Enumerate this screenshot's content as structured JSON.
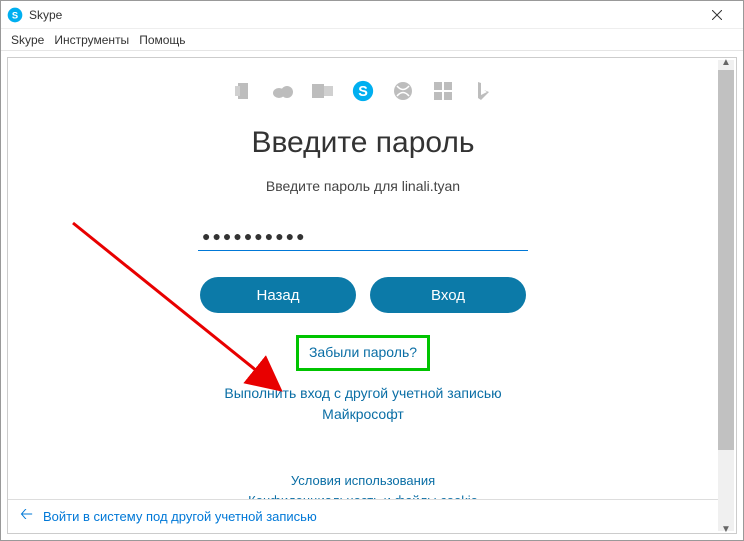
{
  "titlebar": {
    "app_name": "Skype"
  },
  "menubar": {
    "items": [
      "Skype",
      "Инструменты",
      "Помощь"
    ]
  },
  "icons": [
    "office-icon",
    "onedrive-icon",
    "outlook-icon",
    "skype-icon",
    "xbox-icon",
    "windows-icon",
    "bing-icon"
  ],
  "main": {
    "heading": "Введите пароль",
    "subtitle": "Введите пароль для linali.tyan",
    "password_masked": "●●●●●●●●●●",
    "back_label": "Назад",
    "login_label": "Вход",
    "forgot_label": "Забыли пароль?",
    "other_account_line1": "Выполнить вход с другой учетной записью",
    "other_account_line2": "Майкрософт",
    "terms": "Условия использования",
    "privacy": "Конфиденциальность и файлы cookie"
  },
  "bottom": {
    "switch_account": "Войти в систему под другой учетной записью"
  }
}
